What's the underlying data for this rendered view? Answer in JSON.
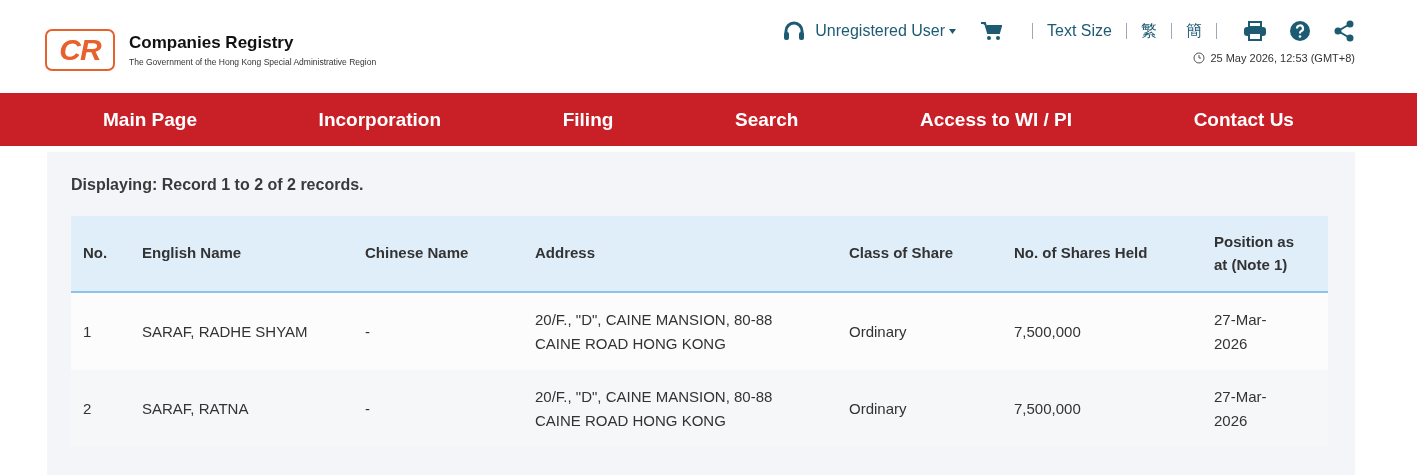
{
  "header": {
    "logo": "CR",
    "title": "Companies Registry",
    "subtitle": "The Government of the Hong Kong Special Administrative Region",
    "user": "Unregistered User",
    "text_size": "Text Size",
    "lang_traditional": "繁",
    "lang_simplified": "簡",
    "datetime": "25 May 2026, 12:53 (GMT+8)"
  },
  "nav": [
    {
      "label": "Main Page"
    },
    {
      "label": "Incorporation"
    },
    {
      "label": "Filing"
    },
    {
      "label": "Search"
    },
    {
      "label": "Access to WI / PI"
    },
    {
      "label": "Contact Us"
    }
  ],
  "summary": "Displaying: Record 1 to 2 of 2 records.",
  "table": {
    "columns": [
      "No.",
      "English Name",
      "Chinese Name",
      "Address",
      "Class of Share",
      "No. of Shares Held",
      "Position as at (Note 1)"
    ],
    "rows": [
      [
        "1",
        "SARAF, RADHE SHYAM",
        "-",
        "20/F., \"D\", CAINE MANSION, 80-88 CAINE ROAD HONG KONG",
        "Ordinary",
        "7,500,000",
        "27-Mar-2026"
      ],
      [
        "2",
        "SARAF, RATNA",
        "-",
        "20/F., \"D\", CAINE MANSION, 80-88 CAINE ROAD HONG KONG",
        "Ordinary",
        "7,500,000",
        "27-Mar-2026"
      ]
    ]
  }
}
